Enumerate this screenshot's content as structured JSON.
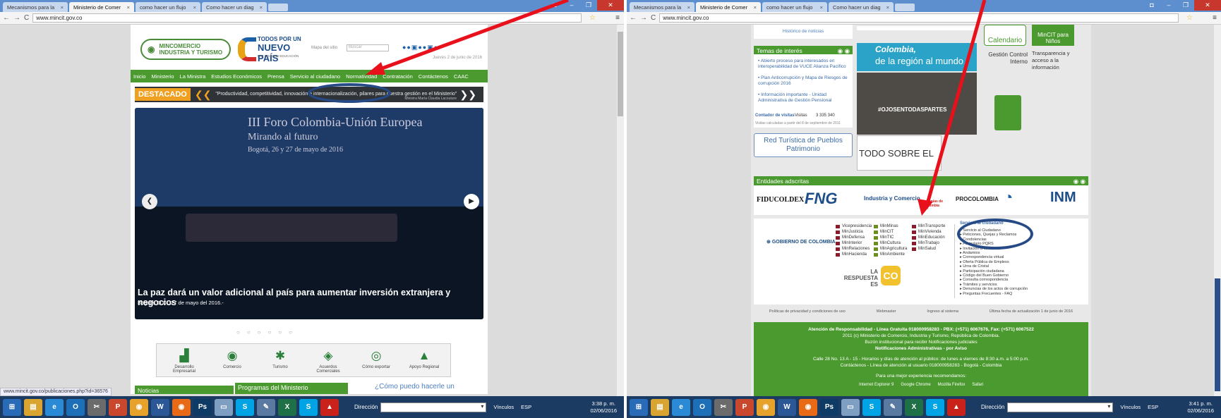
{
  "left": {
    "tabs": [
      "Mecanismos para la",
      "Ministerio de Comer",
      "como hacer un flujo",
      "Como hacer un diag"
    ],
    "url": "www.mincit.gov.co",
    "site": {
      "logo_line1": "MINCOMERCIO",
      "logo_line2": "INDUSTRIA Y TURISMO",
      "brand_top": "TODOS POR UN",
      "brand_main": "NUEVO PAÍS",
      "brand_sub": "PAZ  EQUIDAD  EDUCACIÓN",
      "sitemap_label": "Mapa del sitio",
      "search_placeholder": "Buscar",
      "date": "Jueves 2 de junio de 2016",
      "nav": [
        "Inicio",
        "Ministerio",
        "La Ministra",
        "Estudios Económicos",
        "Prensa",
        "Servicio al ciudadano",
        "Normatividad",
        "Contratación",
        "Contáctenos",
        "CAAC"
      ],
      "destacado_label": "DESTACADO",
      "destacado_quote": "\"Productividad, competitividad, innovación e internacionalización, pilares para nuestra gestión en el Ministerio\"",
      "destacado_author": "Ministra María Claudia Lacouture",
      "hero_title": "III Foro Colombia-Unión Europea",
      "hero_subtitle": "Mirando al futuro",
      "hero_date": "Bogotá, 26 y 27 de mayo de 2016",
      "hero_caption": "La paz dará un valor adicional al país para aumentar inversión extranjera y negocios",
      "hero_caption_sub": "Bogotá, D.C., 27 de mayo del 2016.-",
      "quicklinks": [
        "Desarrollo Empresarial",
        "Comercio",
        "Turismo",
        "Acuerdos Comerciales",
        "Cómo exportar",
        "Apoyo Regional"
      ],
      "card_noticias": "Noticias",
      "card_programas": "Programas del Ministerio",
      "card_puedo": "¿Cómo puedo hacerle un"
    },
    "status_url": "www.mincit.gov.co/publicaciones.php?id=36576",
    "clock_time": "3:38 p. m.",
    "clock_date": "02/06/2016"
  },
  "right": {
    "tabs": [
      "Mecanismos para la",
      "Ministerio de Comer",
      "como hacer un flujo",
      "Como hacer un diag"
    ],
    "url": "www.mincit.gov.co",
    "site": {
      "historico": "Histórico de noticias",
      "temas_title": "Temas de interés",
      "temas": [
        "Abierto proceso para interesados en interoperabilidad de VUCE Alianza Pacífico",
        "Plan Anticorrupción y Mapa de Riesgos de corrupción 2016",
        "Información importante - Unidad Administrativa de Gestión Pensional"
      ],
      "contador_label": "Contador de visitas",
      "visitas_label": "Visitas",
      "visitas_value": "3 335 340",
      "visitas_note": "Visitas calculadas a partir del 8 de septiembre de 2011",
      "red_turistica": "Red Turística de Pueblos Patrimonio",
      "colombia_banner1": "Colombia,",
      "colombia_banner2": "de la región al mundo",
      "ojos_banner": "#OJOSENTODASPARTES",
      "zika": "TODO SOBRE EL VIRUS DEL ZIKA",
      "calendario": "Calendario",
      "mincit_ninos": "MinCIT para Niños",
      "gestion": "Gestión Control Interno",
      "transparencia": "Transparencia y acceso a la información",
      "entidades_title": "Entidades adscritas",
      "entidades": [
        "FIDUCOLDEX",
        "FNG",
        "Industria y Comercio",
        "artesanías de colombia",
        "PROCOLOMBIA",
        "INM"
      ],
      "gobierno": "GOBIERNO DE COLOMBIA",
      "ministerios_col1": [
        "Vicepresidencia",
        "MinJusticia",
        "MinDefensa",
        "MinInterior",
        "MinRelaciones",
        "MinHacienda"
      ],
      "ministerios_col2": [
        "MinMinas",
        "MinCIT",
        "MinTIC",
        "MinCultura",
        "MinAgricultura",
        "MinAmbiente"
      ],
      "ministerios_col3": [
        "MinTransporte",
        "MinVivienda",
        "MinEducación",
        "MinTrabajo",
        "MinSalud"
      ],
      "respuesta": "LA RESPUESTA ES",
      "servicio_title": "Servicio al ciudadano",
      "servicio": [
        "Servicio al Ciudadano",
        "Peticiones, Quejas y Reclamos",
        "Condolencias",
        "Formulario PQRS",
        "Invitación a consulta",
        "Andamios",
        "Correspondencia virtual",
        "Oferta Pública de Empleos",
        "Urna de Cristal",
        "Participación ciudadana",
        "Código del Buen Gobierno",
        "Consulta correspondencia",
        "Trámites y servicios",
        "Denuncias de los actos de corrupción",
        "Preguntas Frecuentes - FAQ"
      ],
      "footer_links": [
        "Políticas de privacidad y condiciones de uso",
        "Webmaster",
        "Ingreso al sistema",
        "Última fecha de actualización 1 de junio de 2016"
      ],
      "footer_l1": "Atención de Responsabilidad - Línea Gratuita 018000958283 - PBX: (+571) 6067676, Fax: (+571) 6067522",
      "footer_l2": "2011 (c) Ministerio de Comercio, Industria y Turismo, República de Colombia.",
      "footer_l3": "Buzón institucional para recibir Notificaciones judiciales",
      "footer_l4": "Notificaciones Administrativas - por Aviso",
      "footer_l5": "Calle 28 No. 13 A - 15 - Horarios y días de atención al público: de lunes a viernes de 8:30 a.m. a 5:00 p.m.",
      "footer_l6": "Contáctenos - Línea de atención al usuario 018000958283 - Bogotá - Colombia",
      "footer_l7": "Para una mejor experiencia recomendamos:",
      "browsers": [
        "Internet Explorer 9",
        "Google Chrome",
        "Mozilla Firefox",
        "Safari"
      ]
    },
    "clock_time": "3:41 p. m.",
    "clock_date": "02/06/2016"
  },
  "taskbar": {
    "direccion": "Dirección",
    "vinculos": "Vínculos",
    "lang": "ESP"
  },
  "colors": {
    "green": "#4b9a2f",
    "accent": "#f0a020",
    "annotation_red": "#e8101a",
    "annotation_oval": "#264a86"
  }
}
